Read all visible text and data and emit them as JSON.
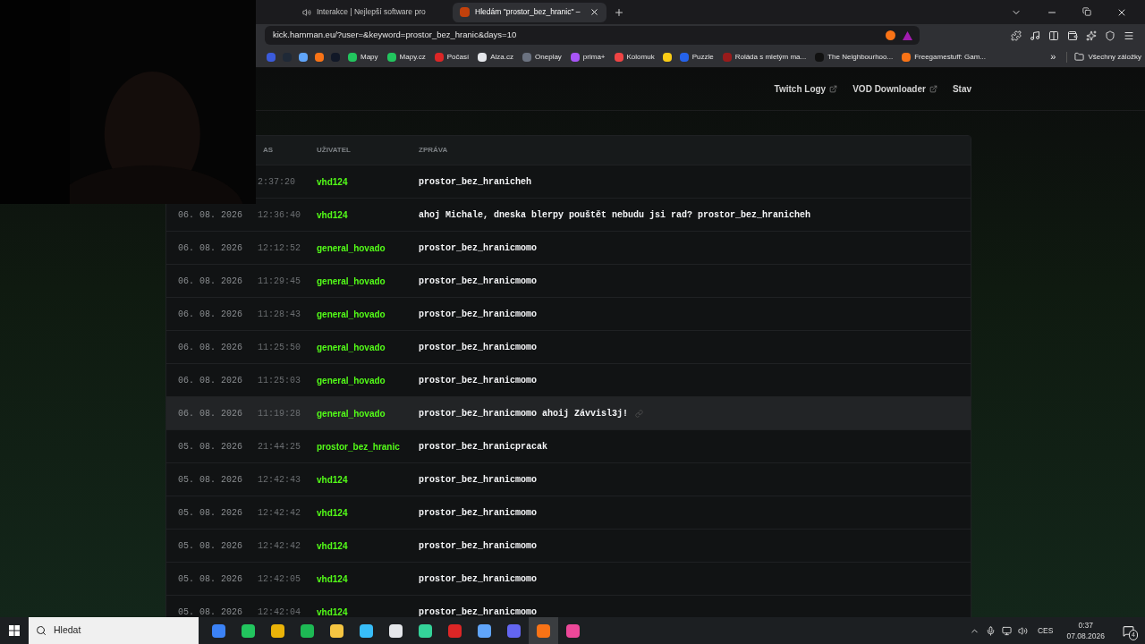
{
  "browser": {
    "tabs": [
      {
        "title": "Interakce | Nejlepší software pro",
        "selected": false
      },
      {
        "title": "Hledám \"prostor_bez_hranic\" –",
        "selected": true
      }
    ],
    "address": "kick.hamman.eu/?user=&keyword=prostor_bez_hranic&days=10",
    "bookmarks": [
      {
        "kind": "icon"
      },
      {
        "kind": "icon"
      },
      {
        "kind": "icon"
      },
      {
        "kind": "icon"
      },
      {
        "kind": "icon"
      },
      {
        "label": "Mapy"
      },
      {
        "label": "Mapy.cz"
      },
      {
        "label": "Počasí"
      },
      {
        "label": "Alza.cz"
      },
      {
        "label": "Oneplay"
      },
      {
        "label": "prima+"
      },
      {
        "label": "Kolomuk"
      },
      {
        "kind": "icon"
      },
      {
        "label": "Puzzle"
      },
      {
        "label": "Roláda s mletým ma..."
      },
      {
        "label": "The Neighbourhoo..."
      },
      {
        "label": "Freegamestuff: Gam..."
      }
    ],
    "more": "»",
    "all_bookmarks": "Všechny záložky"
  },
  "nav": [
    "Twitch Logy",
    "VOD Downloader",
    "Stav"
  ],
  "table": {
    "columns": [
      "AS",
      "UŽIVATEL",
      "ZPRÁVA"
    ],
    "rows": [
      {
        "date": "",
        "time": "2:37:20",
        "user": "vhd124",
        "message": "prostor_bez_hranicheh",
        "highlighted": false
      },
      {
        "date": "06. 08. 2026",
        "time": "12:36:40",
        "user": "vhd124",
        "message": "ahoj Michale, dneska blerpy pouštět nebudu jsi rad? prostor_bez_hranicheh",
        "highlighted": false
      },
      {
        "date": "06. 08. 2026",
        "time": "12:12:52",
        "user": "general_hovado",
        "message": "prostor_bez_hranicmomo",
        "highlighted": false
      },
      {
        "date": "06. 08. 2026",
        "time": "11:29:45",
        "user": "general_hovado",
        "message": "prostor_bez_hranicmomo",
        "highlighted": false
      },
      {
        "date": "06. 08. 2026",
        "time": "11:28:43",
        "user": "general_hovado",
        "message": "prostor_bez_hranicmomo",
        "highlighted": false
      },
      {
        "date": "06. 08. 2026",
        "time": "11:25:50",
        "user": "general_hovado",
        "message": "prostor_bez_hranicmomo",
        "highlighted": false
      },
      {
        "date": "06. 08. 2026",
        "time": "11:25:03",
        "user": "general_hovado",
        "message": "prostor_bez_hranicmomo",
        "highlighted": false
      },
      {
        "date": "06. 08. 2026",
        "time": "11:19:28",
        "user": "general_hovado",
        "message": "prostor_bez_hranicmomo ahoij Závvisl3j!",
        "highlighted": true
      },
      {
        "date": "05. 08. 2026",
        "time": "21:44:25",
        "user": "prostor_bez_hranic",
        "message": "prostor_bez_hranicpracak",
        "highlighted": false
      },
      {
        "date": "05. 08. 2026",
        "time": "12:42:43",
        "user": "vhd124",
        "message": "prostor_bez_hranicmomo",
        "highlighted": false
      },
      {
        "date": "05. 08. 2026",
        "time": "12:42:42",
        "user": "vhd124",
        "message": "prostor_bez_hranicmomo",
        "highlighted": false
      },
      {
        "date": "05. 08. 2026",
        "time": "12:42:42",
        "user": "vhd124",
        "message": "prostor_bez_hranicmomo",
        "highlighted": false
      },
      {
        "date": "05. 08. 2026",
        "time": "12:42:05",
        "user": "vhd124",
        "message": "prostor_bez_hranicmomo",
        "highlighted": false
      },
      {
        "date": "05. 08. 2026",
        "time": "12:42:04",
        "user": "vhd124",
        "message": "prostor_bez_hranicmomo",
        "highlighted": false
      }
    ]
  },
  "taskbar": {
    "search_placeholder": "Hledat",
    "apps": [
      {
        "selected": false
      },
      {
        "selected": false
      },
      {
        "selected": false
      },
      {
        "selected": false
      },
      {
        "selected": false
      },
      {
        "selected": false
      },
      {
        "selected": false
      },
      {
        "selected": false
      },
      {
        "selected": false
      },
      {
        "selected": false
      },
      {
        "selected": false
      },
      {
        "selected": true
      },
      {
        "selected": false
      }
    ],
    "language": "CES",
    "time": "0:37",
    "date": "07.08.2026",
    "notifications": "4"
  }
}
